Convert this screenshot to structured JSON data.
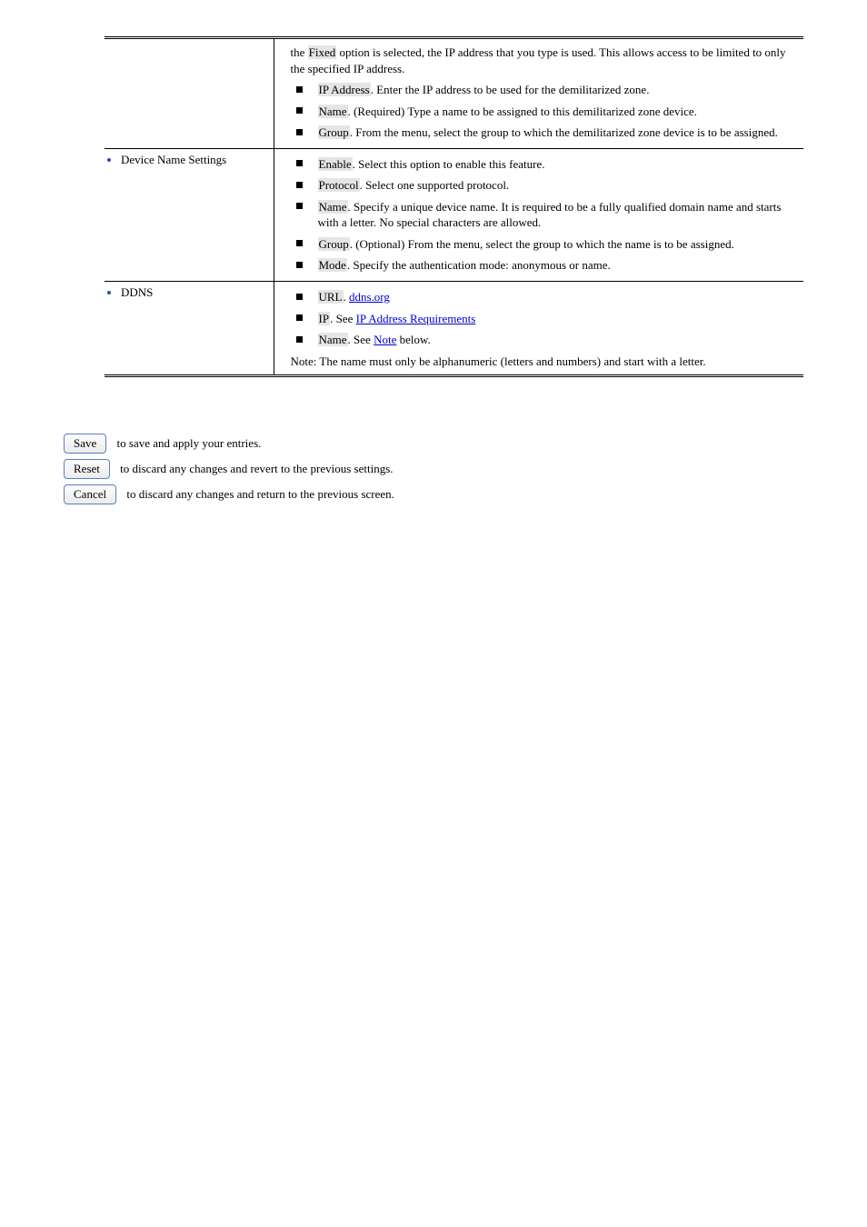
{
  "table": {
    "rows": [
      {
        "left_header": "",
        "pre_paras": [
          "the <hl>Fixed</hl> option is selected, the IP address that you type is used. This allows access to be limited to only the specified IP address."
        ],
        "bullets": [
          {
            "text": "<hl>IP Address</hl>. Enter the IP address to be used for the demilitarized zone."
          },
          {
            "text": "<hl>Name</hl>. (Required) Type a name to be assigned to this demilitarized zone device."
          },
          {
            "text": "<hl>Group</hl>. From the menu, select the group to which the demilitarized zone device is to be assigned."
          }
        ]
      },
      {
        "left_header": "Device Name Settings",
        "pre_paras": [],
        "bullets": [
          {
            "text": "<hl>Enable</hl>. Select this option to enable this feature."
          },
          {
            "text": "<hl>Protocol</hl>. Select one supported protocol."
          },
          {
            "text": "<hl>Name</hl>. Specify a unique device name. It is required to be a fully qualified domain name and starts with a letter. No special characters are allowed."
          },
          {
            "text": "<hl>Group</hl>. (Optional) From the menu, select the group to which the name is to be assigned."
          },
          {
            "text": "<hl>Mode</hl>. Specify the authentication mode: anonymous or name."
          }
        ]
      },
      {
        "left_header": "DDNS",
        "pre_paras": [],
        "bullets": [
          {
            "text": "<hl>URL</hl>. <link href='#'>ddns.org</link>"
          },
          {
            "text": "<hl>IP</hl>. See <link href='#'>IP Address Requirements</link>"
          },
          {
            "text": "<hl>Name</hl>. See <link href='#'>Note</link> below."
          }
        ],
        "post_paras": [
          "Note: The name must only be alphanumeric (letters and numbers) and start with a letter."
        ]
      }
    ]
  },
  "buttons": {
    "save": {
      "label": "Save",
      "desc": "to save and apply your entries."
    },
    "reset": {
      "label": "Reset",
      "desc": "to discard any changes and revert to the previous settings."
    },
    "cancel": {
      "label": "Cancel",
      "desc": "to discard any changes and return to the previous screen."
    }
  }
}
